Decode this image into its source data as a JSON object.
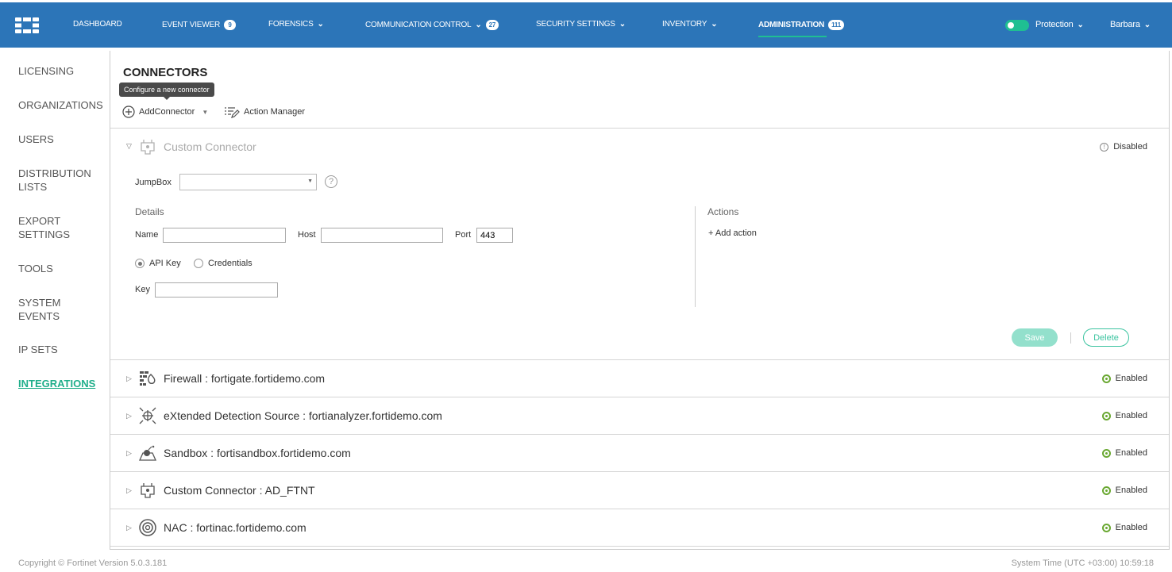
{
  "topbar": {
    "nav": [
      {
        "label": "DASHBOARD"
      },
      {
        "label": "EVENT VIEWER",
        "badge": "9"
      },
      {
        "label": "FORENSICS"
      },
      {
        "label": "COMMUNICATION CONTROL",
        "badge": "27"
      },
      {
        "label": "SECURITY SETTINGS"
      },
      {
        "label": "INVENTORY"
      },
      {
        "label": "ADMINISTRATION",
        "badge": "111"
      }
    ],
    "protection_label": "Protection",
    "user": "Barbara"
  },
  "sidebar": {
    "items": [
      "LICENSING",
      "ORGANIZATIONS",
      "USERS",
      "DISTRIBUTION LISTS",
      "EXPORT SETTINGS",
      "TOOLS",
      "SYSTEM EVENTS",
      "IP SETS",
      "INTEGRATIONS"
    ]
  },
  "main": {
    "title": "CONNECTORS",
    "tooltip": "Configure a new connector",
    "add_connector": "AddConnector",
    "action_manager": "Action Manager",
    "expanded": {
      "label": "Custom Connector",
      "status": "Disabled",
      "jumpbox_label": "JumpBox",
      "jumpbox_value": "",
      "details_label": "Details",
      "name_label": "Name",
      "name_value": "",
      "host_label": "Host",
      "host_value": "",
      "port_label": "Port",
      "port_value": "443",
      "api_key_label": "API Key",
      "credentials_label": "Credentials",
      "key_label": "Key",
      "key_value": "",
      "actions_label": "Actions",
      "add_action": "+ Add action",
      "save": "Save",
      "delete": "Delete"
    },
    "connectors": [
      {
        "label": "Firewall : fortigate.fortidemo.com",
        "status": "Enabled",
        "icon": "firewall-icon"
      },
      {
        "label": "eXtended Detection Source : fortianalyzer.fortidemo.com",
        "status": "Enabled",
        "icon": "detection-icon"
      },
      {
        "label": "Sandbox : fortisandbox.fortidemo.com",
        "status": "Enabled",
        "icon": "sandbox-icon"
      },
      {
        "label": "Custom Connector : AD_FTNT",
        "status": "Enabled",
        "icon": "plug-icon"
      },
      {
        "label": "NAC : fortinac.fortidemo.com",
        "status": "Enabled",
        "icon": "nac-icon"
      }
    ]
  },
  "footer": {
    "copyright": "Copyright © Fortinet Version 5.0.3.181",
    "system_time": "System Time (UTC +03:00) 10:59:18"
  },
  "colors": {
    "topbar": "#2c75b8",
    "accent": "#1fbf92",
    "enabled": "#6aa832"
  }
}
